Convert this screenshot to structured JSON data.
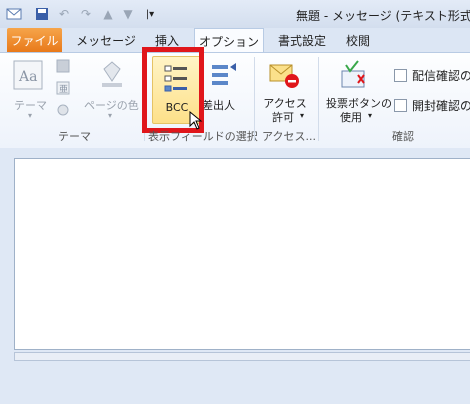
{
  "window": {
    "title": "無題 - メッセージ (テキスト形式)"
  },
  "tabs": {
    "file": "ファイル",
    "message": "メッセージ",
    "insert": "挿入",
    "options": "オプション",
    "format": "書式設定",
    "review": "校閲"
  },
  "ribbon": {
    "themes": {
      "theme": "テーマ",
      "page_color": "ページの色",
      "group": "テーマ"
    },
    "fields": {
      "bcc": "BCC",
      "from": "差出人",
      "group": "表示フィールドの選択"
    },
    "permission": {
      "line1": "アクセス",
      "line2": "許可",
      "group": "アクセス..."
    },
    "tracking": {
      "voting_line1": "投票ボタンの",
      "voting_line2": "使用",
      "delivery_receipt": "配信確認の",
      "read_receipt": "開封確認の",
      "group": "確認"
    }
  },
  "colors": {
    "file_tab": "#e8791a",
    "highlight": "#e0161b",
    "hover": "#fde9a0"
  }
}
